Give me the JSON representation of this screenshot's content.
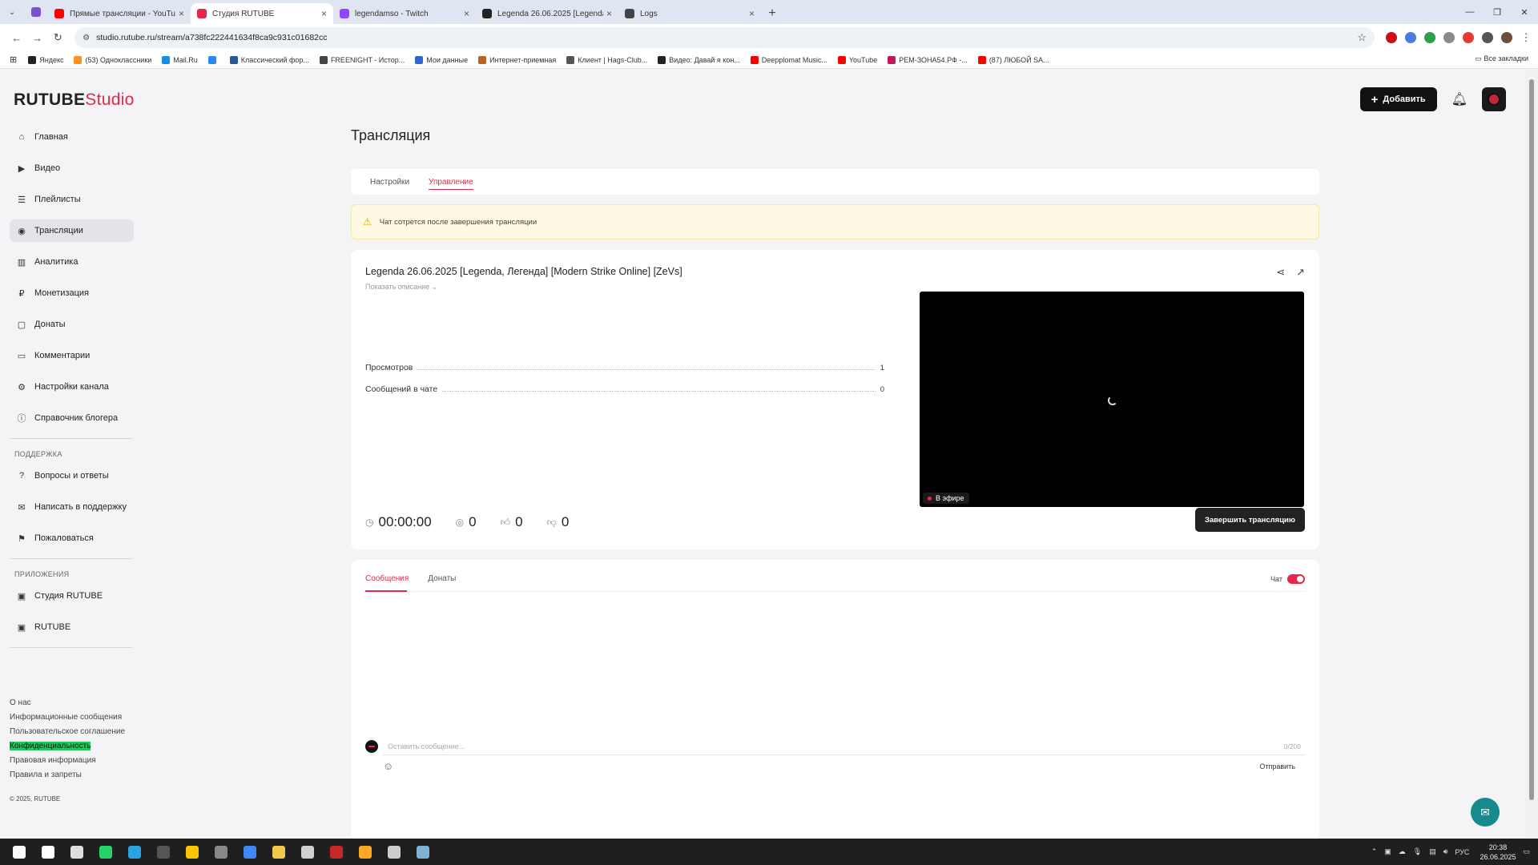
{
  "browser": {
    "tabs": [
      {
        "title": "Прямые трансляции - YouTube",
        "color": "#ff0000",
        "active": false
      },
      {
        "title": "Студия RUTUBE",
        "color": "#e5284a",
        "active": true
      },
      {
        "title": "legendamso - Twitch",
        "color": "#9146ff",
        "active": false
      },
      {
        "title": "Legenda 26.06.2025 [Legenda,",
        "color": "#222222",
        "active": false
      },
      {
        "title": "Logs",
        "color": "#444444",
        "active": false
      }
    ],
    "url": "studio.rutube.ru/stream/a738fc222441634f8ca9c931c01682cc",
    "bookmarks": [
      {
        "label": "Яндекс",
        "color": "#222"
      },
      {
        "label": "(53) Одноклассники",
        "color": "#f7931e"
      },
      {
        "label": "Mail.Ru",
        "color": "#168de2"
      },
      {
        "label": "",
        "color": "#2787f5"
      },
      {
        "label": "Классический фор...",
        "color": "#2b5797"
      },
      {
        "label": "FREENIGHT - Истор...",
        "color": "#444"
      },
      {
        "label": "Мои данные",
        "color": "#3366cc"
      },
      {
        "label": "Интернет-приемная",
        "color": "#b5651d"
      },
      {
        "label": "Клиент | Hags-Club...",
        "color": "#555"
      },
      {
        "label": "Видео: Давай я кон...",
        "color": "#222"
      },
      {
        "label": "Deepplomat Music...",
        "color": "#ff0000"
      },
      {
        "label": "YouTube",
        "color": "#ff0000"
      },
      {
        "label": "РЕМ-ЗОНА54.РФ -...",
        "color": "#c2185b"
      },
      {
        "label": "(87) ЛЮБОЙ SA...",
        "color": "#ff0000"
      }
    ],
    "all_bookmarks": "Все закладки"
  },
  "logo": {
    "part1": "RUTUBE",
    "part2": "Studio"
  },
  "sidebar": {
    "items": [
      {
        "label": "Главная",
        "icon": "home-icon",
        "glyph": "⌂"
      },
      {
        "label": "Видео",
        "icon": "video-icon",
        "glyph": "▶"
      },
      {
        "label": "Плейлисты",
        "icon": "playlist-icon",
        "glyph": "☰"
      },
      {
        "label": "Трансляции",
        "icon": "broadcast-icon",
        "glyph": "◉",
        "active": true
      },
      {
        "label": "Аналитика",
        "icon": "analytics-icon",
        "glyph": "▥"
      },
      {
        "label": "Монетизация",
        "icon": "monetization-icon",
        "glyph": "₽"
      },
      {
        "label": "Донаты",
        "icon": "donate-icon",
        "glyph": "▢"
      },
      {
        "label": "Комментарии",
        "icon": "comments-icon",
        "glyph": "▭"
      },
      {
        "label": "Настройки канала",
        "icon": "settings-icon",
        "glyph": "⚙"
      },
      {
        "label": "Справочник блогера",
        "icon": "info-icon",
        "glyph": "ⓘ"
      }
    ],
    "support_title": "ПОДДЕРЖКА",
    "support": [
      {
        "label": "Вопросы и ответы",
        "icon": "help-icon",
        "glyph": "?"
      },
      {
        "label": "Написать в поддержку",
        "icon": "mail-icon",
        "glyph": "✉"
      },
      {
        "label": "Пожаловаться",
        "icon": "flag-icon",
        "glyph": "⚑"
      }
    ],
    "apps_title": "ПРИЛОЖЕНИЯ",
    "apps": [
      {
        "label": "Студия RUTUBE",
        "icon": "studio-app-icon",
        "glyph": "▣"
      },
      {
        "label": "RUTUBE",
        "icon": "rutube-app-icon",
        "glyph": "▣"
      }
    ],
    "footer": [
      "О нас",
      "Информационные сообщения",
      "Пользовательское соглашение",
      "Конфиденциальность",
      "Правовая информация",
      "Правила и запреты"
    ],
    "copyright": "© 2025, RUTUBE"
  },
  "header": {
    "add_label": "Добавить"
  },
  "page": {
    "title": "Трансляция",
    "tabs": [
      "Настройки",
      "Управление"
    ],
    "active_tab": "Управление",
    "warning": "Чат сотрется после завершения трансляции"
  },
  "stream": {
    "title": "Legenda 26.06.2025 [Legenda, Легенда] [Modern Strike Online] [ZeVs]",
    "show_description": "Показать описание",
    "stats": [
      {
        "label": "Просмотров",
        "value": "1"
      },
      {
        "label": "Сообщений в чате",
        "value": "0"
      }
    ],
    "live_label": "В эфире",
    "duration": "00:00:00",
    "viewers": "0",
    "likes": "0",
    "dislikes": "0",
    "end_label": "Завершить трансляцию"
  },
  "chat": {
    "tabs": [
      "Сообщения",
      "Донаты"
    ],
    "active_tab": "Сообщения",
    "toggle_label": "Чат",
    "toggle_on": true,
    "placeholder": "Оставить сообщение...",
    "counter": "0/200",
    "send_label": "Отправить"
  },
  "taskbar": {
    "time": "20:38",
    "date": "26.06.2025",
    "lang": "РУС",
    "apps": [
      {
        "name": "windows-start-icon",
        "color": "#ffffff"
      },
      {
        "name": "search-icon",
        "color": "#ffffff"
      },
      {
        "name": "task-view-icon",
        "color": "#dddddd"
      },
      {
        "name": "whatsapp-icon",
        "color": "#25d366"
      },
      {
        "name": "telegram-icon",
        "color": "#2aa3e0"
      },
      {
        "name": "app-icon",
        "color": "#555555"
      },
      {
        "name": "app-icon",
        "color": "#f7c600"
      },
      {
        "name": "app-icon",
        "color": "#888888"
      },
      {
        "name": "chrome-icon",
        "color": "#4285f4"
      },
      {
        "name": "file-explorer-icon",
        "color": "#f2c94c"
      },
      {
        "name": "store-icon",
        "color": "#d0d0d0"
      },
      {
        "name": "app-icon",
        "color": "#c62828"
      },
      {
        "name": "app-icon",
        "color": "#f9a825"
      },
      {
        "name": "app-icon",
        "color": "#cccccc"
      },
      {
        "name": "app-icon",
        "color": "#7fb3d5"
      }
    ]
  }
}
